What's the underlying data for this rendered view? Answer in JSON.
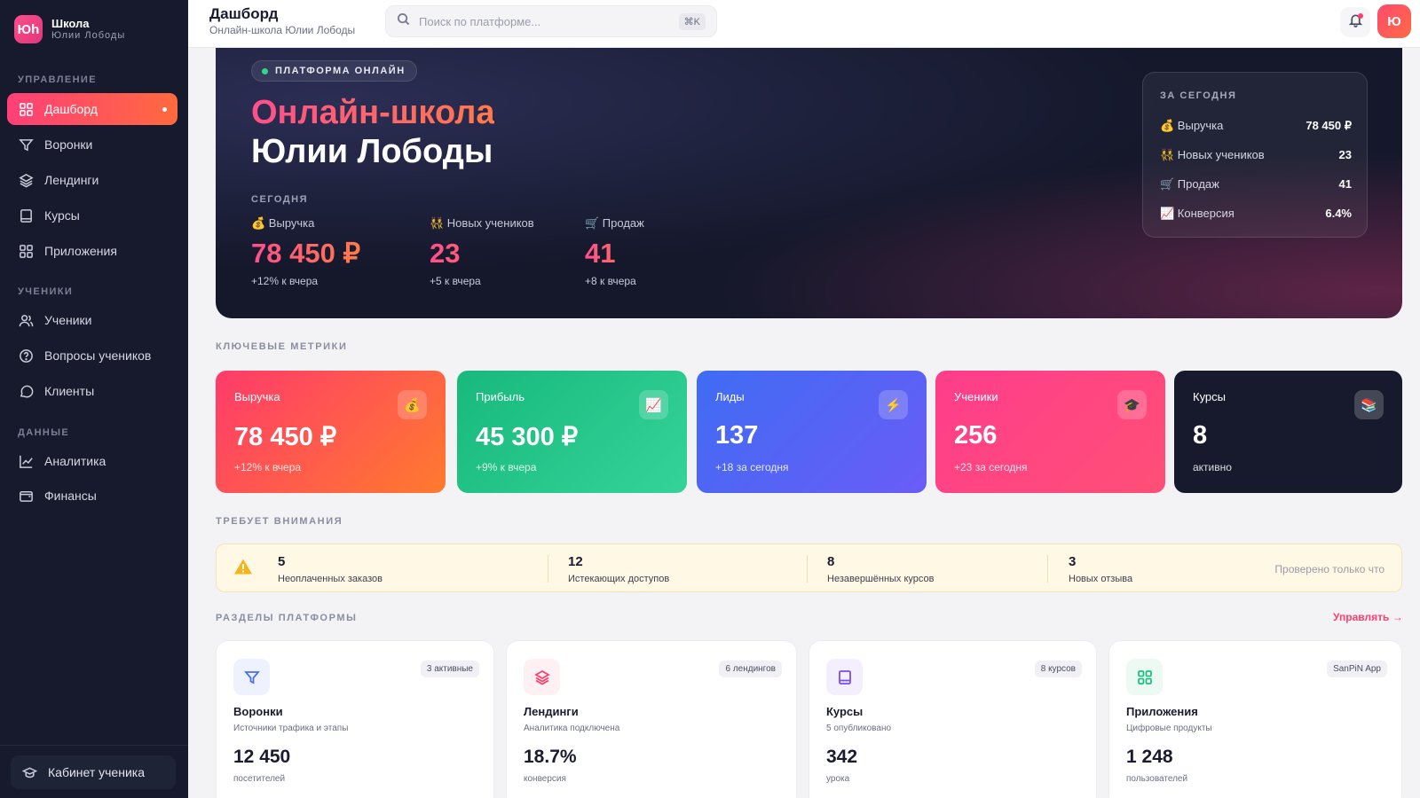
{
  "brand": {
    "logo": "Юh",
    "name": "Школа",
    "sub": "Юлии Лободы"
  },
  "sidebar": {
    "sections": [
      "УПРАВЛЕНИЕ",
      "УЧЕНИКИ",
      "ДАННЫЕ"
    ],
    "items": [
      {
        "label": "Дашборд",
        "icon": "grid-icon",
        "active": true
      },
      {
        "label": "Воронки",
        "icon": "funnel-icon"
      },
      {
        "label": "Лендинги",
        "icon": "layers-icon"
      },
      {
        "label": "Курсы",
        "icon": "book-icon"
      },
      {
        "label": "Приложения",
        "icon": "apps-icon"
      },
      {
        "label": "Ученики",
        "icon": "users-icon"
      },
      {
        "label": "Вопросы учеников",
        "icon": "question-icon"
      },
      {
        "label": "Клиенты",
        "icon": "chat-icon"
      },
      {
        "label": "Аналитика",
        "icon": "chart-icon"
      },
      {
        "label": "Финансы",
        "icon": "wallet-icon"
      }
    ],
    "cabinet": "Кабинет ученика"
  },
  "header": {
    "title": "Дашборд",
    "subtitle": "Онлайн-школа Юлии Лободы",
    "search_placeholder": "Поиск по платформе...",
    "search_shortcut": "⌘K",
    "avatar": "Ю"
  },
  "hero": {
    "badge": "ПЛАТФОРМА ОНЛАЙН",
    "title_line1": "Онлайн-школа",
    "title_line2": "Юлии Лободы",
    "today_label": "СЕГОДНЯ",
    "stats": [
      {
        "label": "💰 Выручка",
        "value": "78 450 ₽",
        "change": "+12% к вчера"
      },
      {
        "label": "👯 Новых учеников",
        "value": "23",
        "change": "+5 к вчера"
      },
      {
        "label": "🛒 Продаж",
        "value": "41",
        "change": "+8 к вчера"
      }
    ],
    "today_card": {
      "title": "ЗА СЕГОДНЯ",
      "rows": [
        {
          "label": "💰 Выручка",
          "value": "78 450 ₽"
        },
        {
          "label": "👯 Новых учеников",
          "value": "23"
        },
        {
          "label": "🛒 Продаж",
          "value": "41"
        },
        {
          "label": "📈 Конверсия",
          "value": "6.4%"
        }
      ]
    }
  },
  "metrics_label": "КЛЮЧЕВЫЕ МЕТРИКИ",
  "metrics": [
    {
      "label": "Выручка",
      "icon": "💰",
      "value": "78 450 ₽",
      "sub": "+12% к вчера",
      "color": "#ff3b6b"
    },
    {
      "label": "Прибыль",
      "icon": "📈",
      "value": "45 300 ₽",
      "sub": "+9% к вчера",
      "color": "#1fbf83"
    },
    {
      "label": "Лиды",
      "icon": "⚡",
      "value": "137",
      "sub": "+18 за сегодня",
      "color": "#4a6ef5"
    },
    {
      "label": "Ученики",
      "icon": "🎓",
      "value": "256",
      "sub": "+23 за сегодня",
      "color": "#ff3d8b"
    },
    {
      "label": "Курсы",
      "icon": "📚",
      "value": "8",
      "sub": "активно",
      "color": "#161a2c"
    }
  ],
  "attention_label": "ТРЕБУЕТ ВНИМАНИЯ",
  "attention": {
    "items": [
      {
        "count": "5",
        "text": "Неоплаченных заказов"
      },
      {
        "count": "12",
        "text": "Истекающих доступов"
      },
      {
        "count": "8",
        "text": "Незавершённых курсов"
      },
      {
        "count": "3",
        "text": "Новых отзыва"
      }
    ],
    "checked": "Проверено только что"
  },
  "sections_label": "РАЗДЕЛЫ ПЛАТФОРМЫ",
  "manage_link": "Управлять →",
  "platform_cards": [
    {
      "title": "Воронки",
      "sub": "Источники трафика и этапы",
      "badge": "3 активные",
      "value": "12 450",
      "unit": "посетителей",
      "icon": "funnel-icon",
      "tint": "#eef2ff",
      "stroke": "#4a6ef5"
    },
    {
      "title": "Лендинги",
      "sub": "Аналитика подключена",
      "badge": "6 лендингов",
      "value": "18.7%",
      "unit": "конверсия",
      "icon": "layers-icon",
      "tint": "#fff0f4",
      "stroke": "#ff3f6e"
    },
    {
      "title": "Курсы",
      "sub": "5 опубликовано",
      "badge": "8 курсов",
      "value": "342",
      "unit": "урока",
      "icon": "book-icon",
      "tint": "#f3efff",
      "stroke": "#7b4ef0"
    },
    {
      "title": "Приложения",
      "sub": "Цифровые продукты",
      "badge": "SanPiN App",
      "value": "1 248",
      "unit": "пользователей",
      "icon": "apps-icon",
      "tint": "#ecfaf3",
      "stroke": "#1fbf83"
    }
  ]
}
